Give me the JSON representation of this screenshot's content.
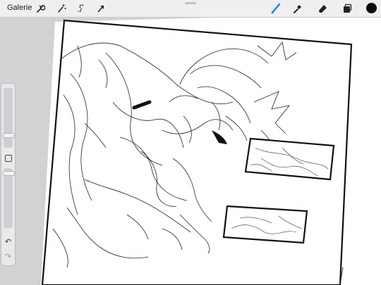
{
  "toolbar": {
    "gallery_label": "Galerie",
    "left_icons": [
      "wrench-icon",
      "magic-wand-icon",
      "selection-s-icon",
      "transform-arrow-icon"
    ],
    "right_icons": [
      "brush-icon",
      "smudge-icon",
      "eraser-icon",
      "layers-icon"
    ],
    "accent_color": "#1e7bf0",
    "current_color": "#0b0b0b"
  },
  "sidebar": {
    "controls": [
      "brush-size-slider",
      "modify-button",
      "opacity-slider",
      "undo-arrow-icon",
      "redo-arrow-icon"
    ]
  }
}
